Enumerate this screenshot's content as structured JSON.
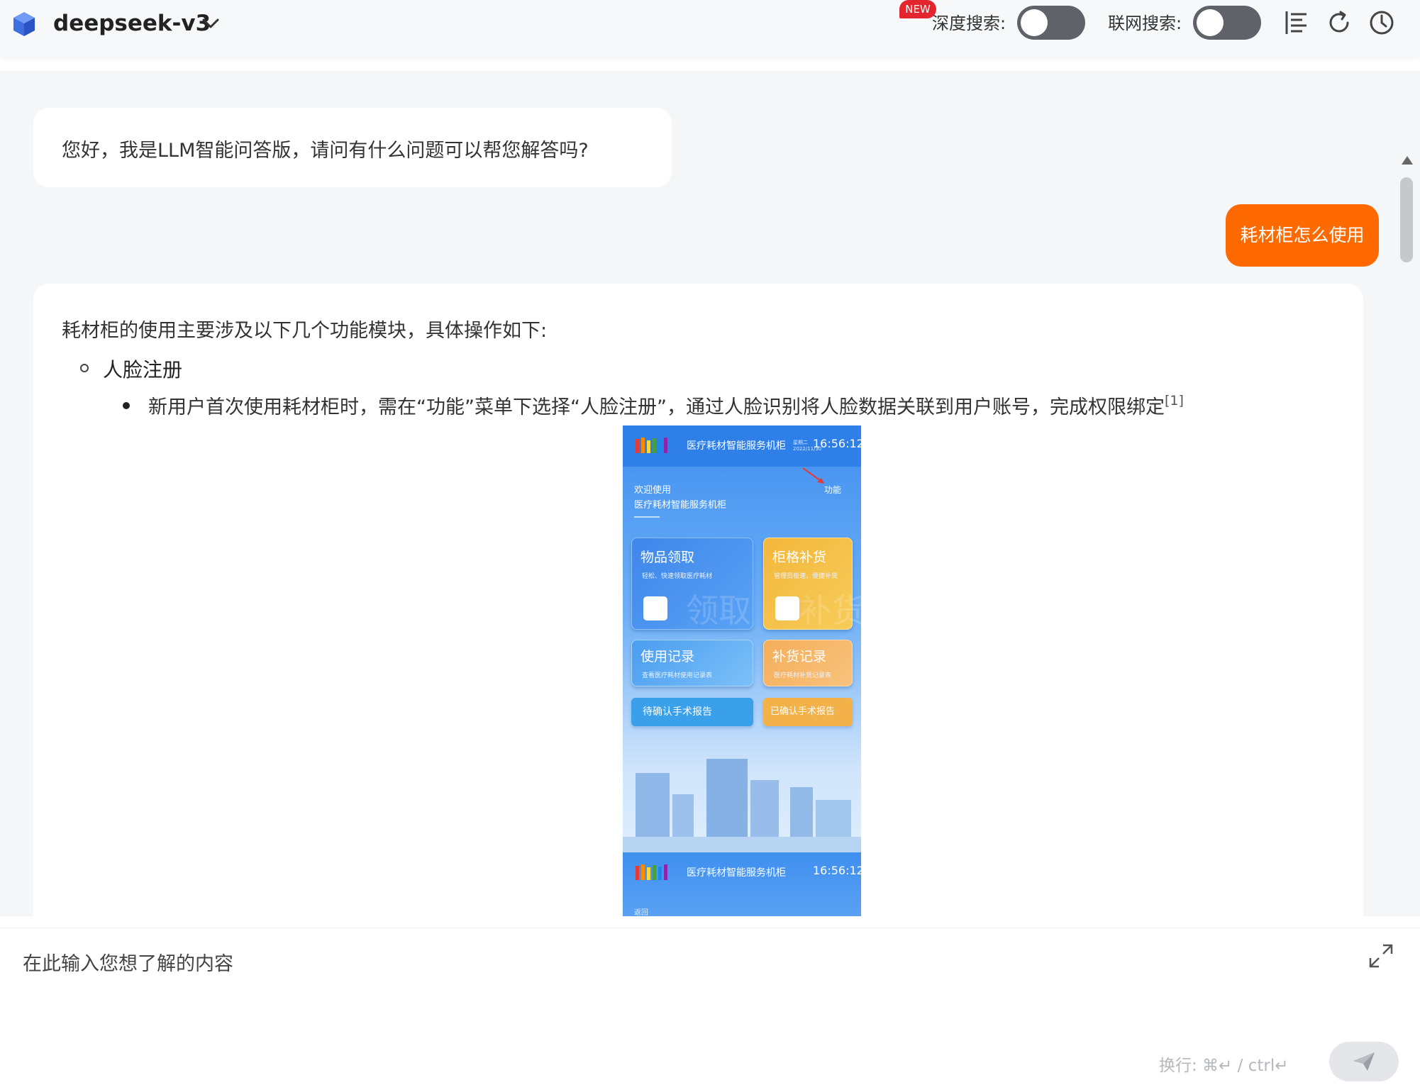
{
  "header": {
    "model_name": "deepseek-v3",
    "new_badge": "NEW",
    "deep_search_label": "深度搜索:",
    "web_search_label": "联网搜索:",
    "deep_search_on": false,
    "web_search_on": false,
    "icons": [
      "cube-logo-icon",
      "chevron-down-icon",
      "list-icon",
      "refresh-icon",
      "history-clock-icon"
    ]
  },
  "chat": {
    "greeting": "您好，我是LLM智能问答版，请问有什么问题可以帮您解答吗?",
    "user_message": "耗材柜怎么使用",
    "answer": {
      "intro": "耗材柜的使用主要涉及以下几个功能模块，具体操作如下:",
      "section_title": "人脸注册",
      "bullet_text": "新用户首次使用耗材柜时，需在“功能”菜单下选择“人脸注册”，通过人脸识别将人脸数据关联到用户账号，完成权限绑定",
      "citation": "[1]"
    },
    "embedded_screenshot": {
      "header_title": "医疗耗材智能服务机柜",
      "time": "16:56:12",
      "date_small": "星期二 2022/11/30",
      "welcome_line1": "欢迎使用",
      "welcome_line2": "医疗耗材智能服务机柜",
      "function_label": "功能",
      "tiles": [
        {
          "title": "物品领取",
          "subtitle": "轻松、快速领取医疗耗材",
          "ghost": "领取"
        },
        {
          "title": "柜格补货",
          "subtitle": "管理员极速，便捷补货",
          "ghost": "补货"
        },
        {
          "title": "使用记录",
          "subtitle": "查看医疗耗材使用记录表"
        },
        {
          "title": "补货记录",
          "subtitle": "医疗耗材补货记录表"
        }
      ],
      "pills": [
        "待确认手术报告",
        "已确认手术报告"
      ],
      "second_header_title": "医疗耗材智能服务机柜",
      "second_time": "16:56:12",
      "back_label": "返回"
    }
  },
  "input": {
    "placeholder": "在此输入您想了解的内容",
    "hint": "换行: ⌘↵ / ctrl↵"
  },
  "colors": {
    "accent": "#ff6a00",
    "toggle_off": "#5f6268",
    "badge_red": "#e3262e",
    "logo_blue": "#3d6fe0"
  }
}
